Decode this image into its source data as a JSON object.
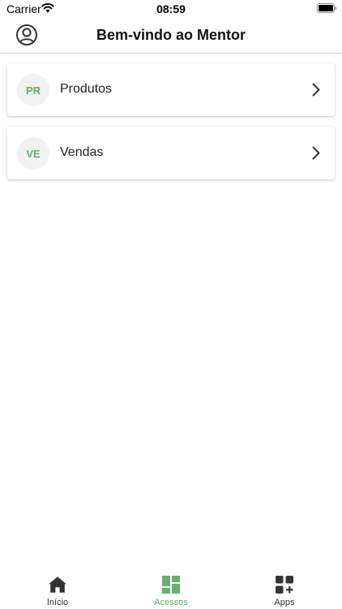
{
  "status_bar": {
    "carrier": "Carrier",
    "time": "08:59"
  },
  "header": {
    "title": "Bem-vindo ao Mentor",
    "profile_icon": "user-circle-icon"
  },
  "items": [
    {
      "initials": "PR",
      "label": "Produtos"
    },
    {
      "initials": "VE",
      "label": "Vendas"
    }
  ],
  "tabs": [
    {
      "label": "Início",
      "icon": "home-icon",
      "active": false
    },
    {
      "label": "Acessos",
      "icon": "grid-icon",
      "active": true
    },
    {
      "label": "Apps",
      "icon": "apps-add-icon",
      "active": false
    }
  ],
  "colors": {
    "accent": "#6aad70",
    "avatar_bg": "#f1f1f1",
    "text": "#222222"
  }
}
